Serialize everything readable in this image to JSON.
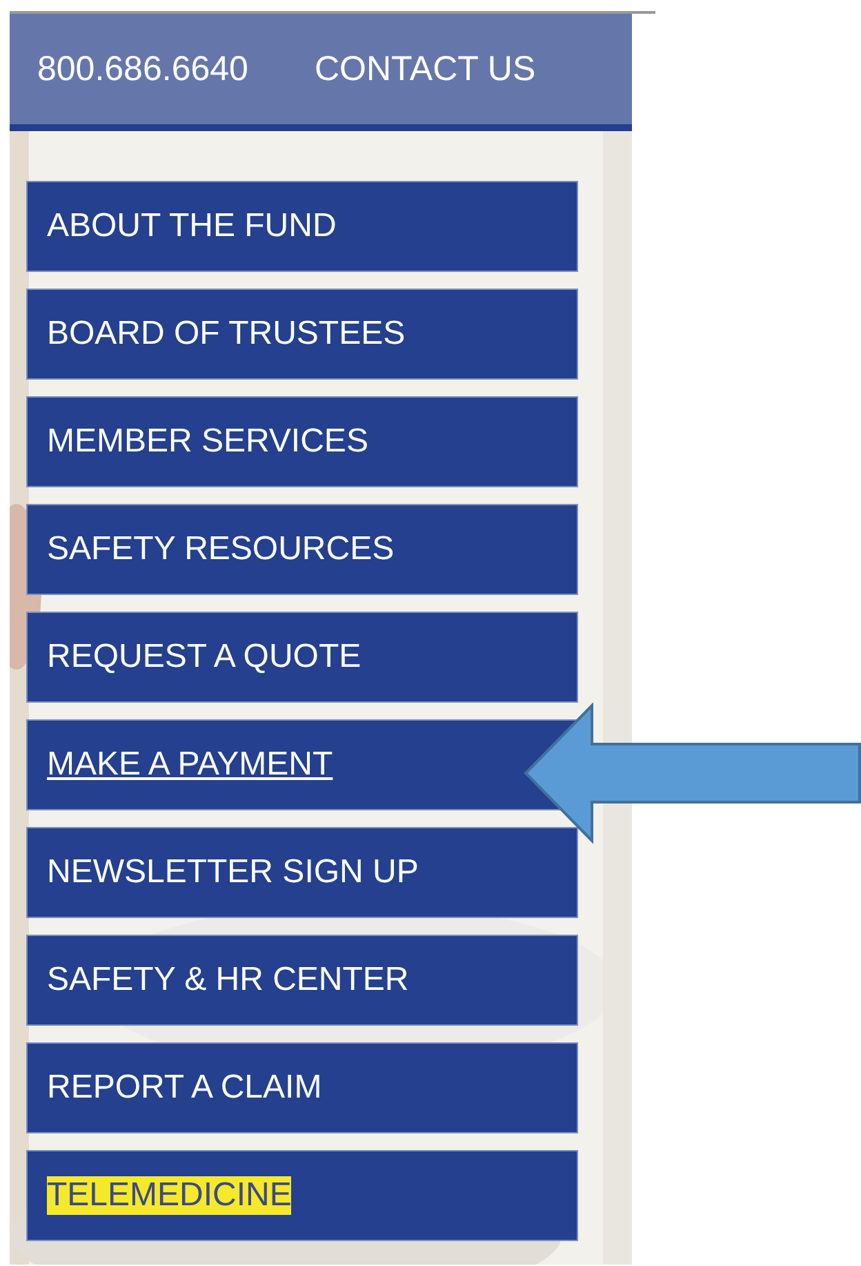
{
  "header": {
    "phone": "800.686.6640",
    "contact": "CONTACT US"
  },
  "menu": [
    {
      "label": "ABOUT THE FUND",
      "underlined": false,
      "highlighted": false
    },
    {
      "label": "BOARD OF TRUSTEES",
      "underlined": false,
      "highlighted": false
    },
    {
      "label": "MEMBER SERVICES",
      "underlined": false,
      "highlighted": false
    },
    {
      "label": "SAFETY RESOURCES",
      "underlined": false,
      "highlighted": false
    },
    {
      "label": "REQUEST A QUOTE",
      "underlined": false,
      "highlighted": false
    },
    {
      "label": "MAKE A PAYMENT",
      "underlined": true,
      "highlighted": false
    },
    {
      "label": "NEWSLETTER SIGN UP",
      "underlined": false,
      "highlighted": false
    },
    {
      "label": "SAFETY & HR CENTER",
      "underlined": false,
      "highlighted": false
    },
    {
      "label": "REPORT A CLAIM",
      "underlined": false,
      "highlighted": false
    },
    {
      "label": "TELEMEDICINE",
      "underlined": false,
      "highlighted": true
    }
  ]
}
